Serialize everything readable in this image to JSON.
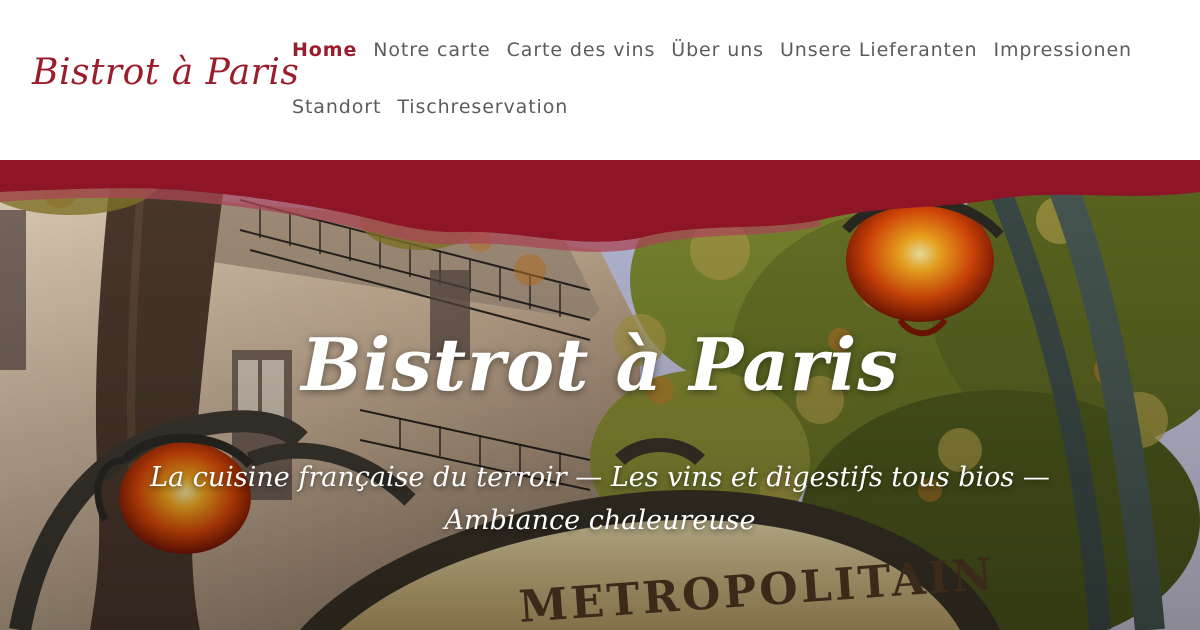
{
  "site": {
    "logo_text": "Bistrot à Paris",
    "brand_color": "#9b1c2b"
  },
  "nav": {
    "items": [
      {
        "label": "Home",
        "active": true
      },
      {
        "label": "Notre carte",
        "active": false
      },
      {
        "label": "Carte des vins",
        "active": false
      },
      {
        "label": "Über uns",
        "active": false
      },
      {
        "label": "Unsere Lieferanten",
        "active": false
      },
      {
        "label": "Impressionen",
        "active": false
      },
      {
        "label": "Standort",
        "active": false
      },
      {
        "label": "Tischreservation",
        "active": false
      }
    ]
  },
  "hero": {
    "title": "Bistrot à Paris",
    "subtitle": "La cuisine française du terroir — Les vins et digestifs tous bios — Ambiance chaleureuse",
    "sign_text": "METROPOLITAIN",
    "background_icon": "paris-metro-entrance-photo"
  }
}
